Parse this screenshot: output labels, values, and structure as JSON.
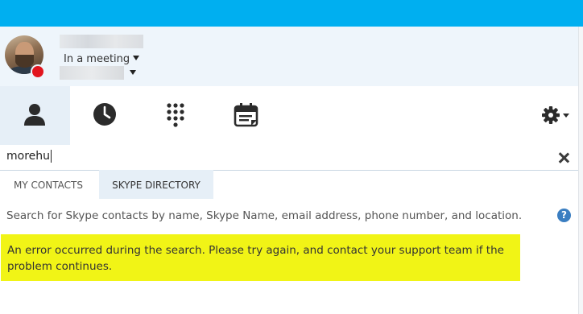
{
  "profile": {
    "status": "In a meeting",
    "presence_color": "#e2151e"
  },
  "nav": {
    "tabs": [
      {
        "icon": "contacts-person-icon"
      },
      {
        "icon": "recent-clock-icon"
      },
      {
        "icon": "dialpad-icon"
      },
      {
        "icon": "meetings-calendar-icon"
      }
    ],
    "settings_icon": "gear-icon"
  },
  "search": {
    "value": "morehu"
  },
  "tabs": {
    "my_contacts": "MY CONTACTS",
    "skype_directory": "SKYPE DIRECTORY"
  },
  "directory": {
    "info": "Search for Skype contacts by name, Skype Name, email address, phone number, and location.",
    "help_glyph": "?",
    "error": "An error occurred during the search. Please try again, and contact your support team if the problem continues."
  },
  "colors": {
    "accent": "#00aff0",
    "highlight": "#f1f416",
    "active_tab": "#e6eff7"
  }
}
